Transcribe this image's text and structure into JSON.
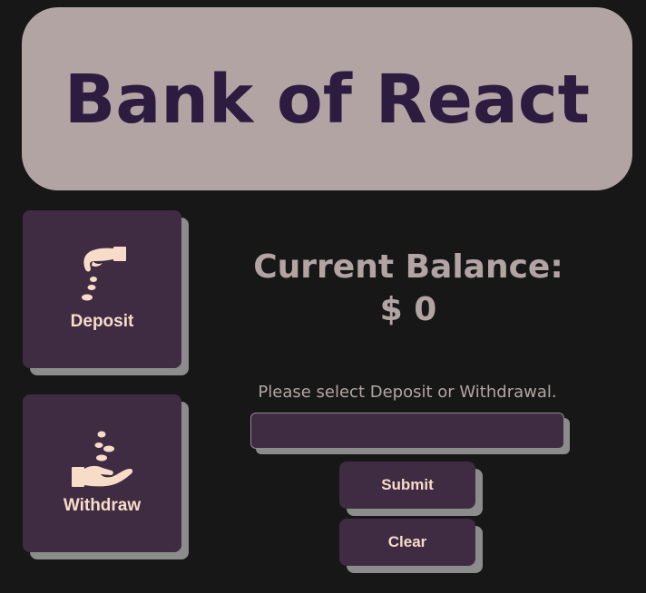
{
  "header": {
    "title": "Bank of React"
  },
  "actions": {
    "deposit": {
      "label": "Deposit",
      "icon": "hand-dropping-coins-icon"
    },
    "withdraw": {
      "label": "Withdraw",
      "icon": "hand-receiving-coins-icon"
    }
  },
  "balance": {
    "title": "Current Balance:",
    "value": "$ 0"
  },
  "form": {
    "prompt": "Please select Deposit or Withdrawal.",
    "amount_value": "",
    "submit_label": "Submit",
    "clear_label": "Clear"
  },
  "colors": {
    "background": "#171717",
    "header_bg": "#b3a4a4",
    "title": "#2e1c40",
    "card_bg": "#3f2c42",
    "shadow": "#8c8c8c",
    "label": "#f7dcc8"
  }
}
